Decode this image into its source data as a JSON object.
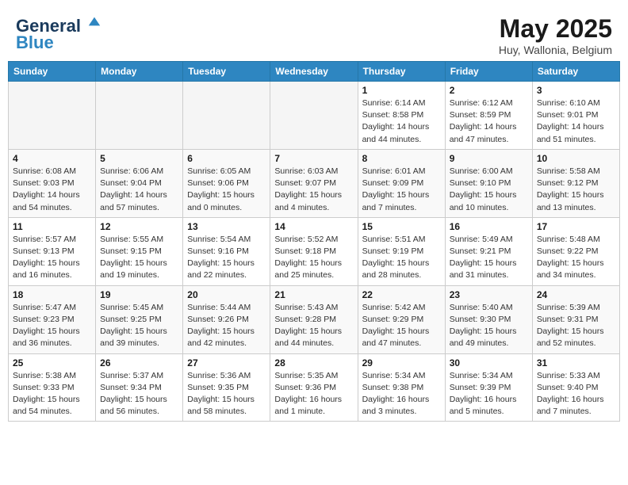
{
  "header": {
    "logo_line1": "General",
    "logo_line2": "Blue",
    "month_year": "May 2025",
    "location": "Huy, Wallonia, Belgium"
  },
  "weekdays": [
    "Sunday",
    "Monday",
    "Tuesday",
    "Wednesday",
    "Thursday",
    "Friday",
    "Saturday"
  ],
  "weeks": [
    [
      {
        "day": "",
        "sunrise": "",
        "sunset": "",
        "daylight": ""
      },
      {
        "day": "",
        "sunrise": "",
        "sunset": "",
        "daylight": ""
      },
      {
        "day": "",
        "sunrise": "",
        "sunset": "",
        "daylight": ""
      },
      {
        "day": "",
        "sunrise": "",
        "sunset": "",
        "daylight": ""
      },
      {
        "day": "1",
        "sunrise": "Sunrise: 6:14 AM",
        "sunset": "Sunset: 8:58 PM",
        "daylight": "Daylight: 14 hours and 44 minutes."
      },
      {
        "day": "2",
        "sunrise": "Sunrise: 6:12 AM",
        "sunset": "Sunset: 8:59 PM",
        "daylight": "Daylight: 14 hours and 47 minutes."
      },
      {
        "day": "3",
        "sunrise": "Sunrise: 6:10 AM",
        "sunset": "Sunset: 9:01 PM",
        "daylight": "Daylight: 14 hours and 51 minutes."
      }
    ],
    [
      {
        "day": "4",
        "sunrise": "Sunrise: 6:08 AM",
        "sunset": "Sunset: 9:03 PM",
        "daylight": "Daylight: 14 hours and 54 minutes."
      },
      {
        "day": "5",
        "sunrise": "Sunrise: 6:06 AM",
        "sunset": "Sunset: 9:04 PM",
        "daylight": "Daylight: 14 hours and 57 minutes."
      },
      {
        "day": "6",
        "sunrise": "Sunrise: 6:05 AM",
        "sunset": "Sunset: 9:06 PM",
        "daylight": "Daylight: 15 hours and 0 minutes."
      },
      {
        "day": "7",
        "sunrise": "Sunrise: 6:03 AM",
        "sunset": "Sunset: 9:07 PM",
        "daylight": "Daylight: 15 hours and 4 minutes."
      },
      {
        "day": "8",
        "sunrise": "Sunrise: 6:01 AM",
        "sunset": "Sunset: 9:09 PM",
        "daylight": "Daylight: 15 hours and 7 minutes."
      },
      {
        "day": "9",
        "sunrise": "Sunrise: 6:00 AM",
        "sunset": "Sunset: 9:10 PM",
        "daylight": "Daylight: 15 hours and 10 minutes."
      },
      {
        "day": "10",
        "sunrise": "Sunrise: 5:58 AM",
        "sunset": "Sunset: 9:12 PM",
        "daylight": "Daylight: 15 hours and 13 minutes."
      }
    ],
    [
      {
        "day": "11",
        "sunrise": "Sunrise: 5:57 AM",
        "sunset": "Sunset: 9:13 PM",
        "daylight": "Daylight: 15 hours and 16 minutes."
      },
      {
        "day": "12",
        "sunrise": "Sunrise: 5:55 AM",
        "sunset": "Sunset: 9:15 PM",
        "daylight": "Daylight: 15 hours and 19 minutes."
      },
      {
        "day": "13",
        "sunrise": "Sunrise: 5:54 AM",
        "sunset": "Sunset: 9:16 PM",
        "daylight": "Daylight: 15 hours and 22 minutes."
      },
      {
        "day": "14",
        "sunrise": "Sunrise: 5:52 AM",
        "sunset": "Sunset: 9:18 PM",
        "daylight": "Daylight: 15 hours and 25 minutes."
      },
      {
        "day": "15",
        "sunrise": "Sunrise: 5:51 AM",
        "sunset": "Sunset: 9:19 PM",
        "daylight": "Daylight: 15 hours and 28 minutes."
      },
      {
        "day": "16",
        "sunrise": "Sunrise: 5:49 AM",
        "sunset": "Sunset: 9:21 PM",
        "daylight": "Daylight: 15 hours and 31 minutes."
      },
      {
        "day": "17",
        "sunrise": "Sunrise: 5:48 AM",
        "sunset": "Sunset: 9:22 PM",
        "daylight": "Daylight: 15 hours and 34 minutes."
      }
    ],
    [
      {
        "day": "18",
        "sunrise": "Sunrise: 5:47 AM",
        "sunset": "Sunset: 9:23 PM",
        "daylight": "Daylight: 15 hours and 36 minutes."
      },
      {
        "day": "19",
        "sunrise": "Sunrise: 5:45 AM",
        "sunset": "Sunset: 9:25 PM",
        "daylight": "Daylight: 15 hours and 39 minutes."
      },
      {
        "day": "20",
        "sunrise": "Sunrise: 5:44 AM",
        "sunset": "Sunset: 9:26 PM",
        "daylight": "Daylight: 15 hours and 42 minutes."
      },
      {
        "day": "21",
        "sunrise": "Sunrise: 5:43 AM",
        "sunset": "Sunset: 9:28 PM",
        "daylight": "Daylight: 15 hours and 44 minutes."
      },
      {
        "day": "22",
        "sunrise": "Sunrise: 5:42 AM",
        "sunset": "Sunset: 9:29 PM",
        "daylight": "Daylight: 15 hours and 47 minutes."
      },
      {
        "day": "23",
        "sunrise": "Sunrise: 5:40 AM",
        "sunset": "Sunset: 9:30 PM",
        "daylight": "Daylight: 15 hours and 49 minutes."
      },
      {
        "day": "24",
        "sunrise": "Sunrise: 5:39 AM",
        "sunset": "Sunset: 9:31 PM",
        "daylight": "Daylight: 15 hours and 52 minutes."
      }
    ],
    [
      {
        "day": "25",
        "sunrise": "Sunrise: 5:38 AM",
        "sunset": "Sunset: 9:33 PM",
        "daylight": "Daylight: 15 hours and 54 minutes."
      },
      {
        "day": "26",
        "sunrise": "Sunrise: 5:37 AM",
        "sunset": "Sunset: 9:34 PM",
        "daylight": "Daylight: 15 hours and 56 minutes."
      },
      {
        "day": "27",
        "sunrise": "Sunrise: 5:36 AM",
        "sunset": "Sunset: 9:35 PM",
        "daylight": "Daylight: 15 hours and 58 minutes."
      },
      {
        "day": "28",
        "sunrise": "Sunrise: 5:35 AM",
        "sunset": "Sunset: 9:36 PM",
        "daylight": "Daylight: 16 hours and 1 minute."
      },
      {
        "day": "29",
        "sunrise": "Sunrise: 5:34 AM",
        "sunset": "Sunset: 9:38 PM",
        "daylight": "Daylight: 16 hours and 3 minutes."
      },
      {
        "day": "30",
        "sunrise": "Sunrise: 5:34 AM",
        "sunset": "Sunset: 9:39 PM",
        "daylight": "Daylight: 16 hours and 5 minutes."
      },
      {
        "day": "31",
        "sunrise": "Sunrise: 5:33 AM",
        "sunset": "Sunset: 9:40 PM",
        "daylight": "Daylight: 16 hours and 7 minutes."
      }
    ]
  ]
}
